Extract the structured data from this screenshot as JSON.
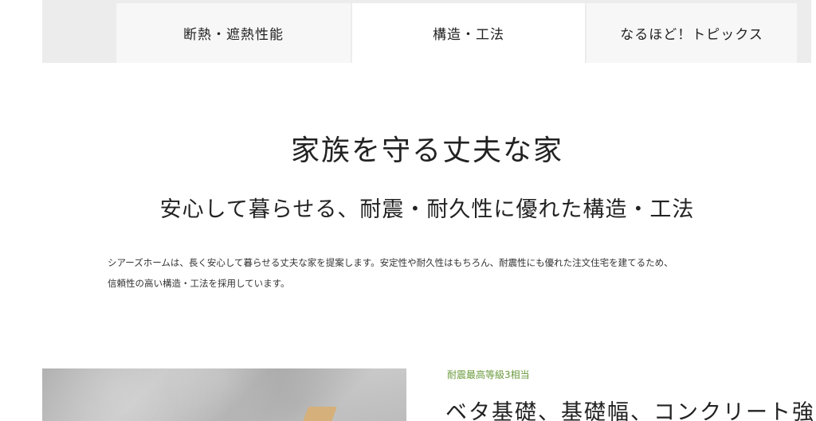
{
  "nav": {
    "tabs": [
      {
        "label": "断熱・遮熱性能",
        "active": false
      },
      {
        "label": "構造・工法",
        "active": true
      },
      {
        "label": "なるほど！トピックス",
        "active": false
      }
    ]
  },
  "hero": {
    "title": "家族を守る丈夫な家",
    "subtitle": "安心して暮らせる、耐震・耐久性に優れた構造・工法"
  },
  "intro": {
    "line1": "シアーズホームは、長く安心して暮らせる丈夫な家を提案します。安定性や耐久性はもちろん、耐震性にも優れた注文住宅を建てるため、",
    "line2": "信頼性の高い構造・工法を採用しています。"
  },
  "feature": {
    "tag": "耐震最高等級3相当",
    "title": "ベタ基礎、基礎幅、コンクリート強"
  },
  "colors": {
    "accent_green": "#6a9a3c",
    "tab_band": "#ececec",
    "tab_inactive": "#f7f7f7",
    "tab_active": "#ffffff"
  }
}
